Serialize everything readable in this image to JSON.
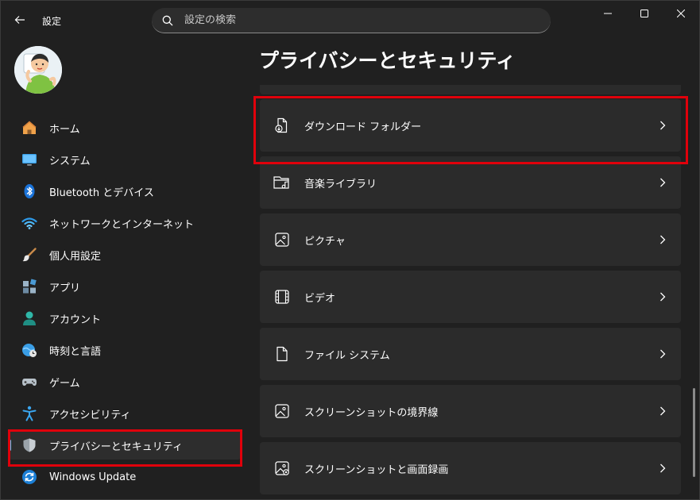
{
  "titlebar": {
    "app_title": "設定",
    "search_placeholder": "設定の検索"
  },
  "page": {
    "title": "プライバシーとセキュリティ"
  },
  "sidebar": {
    "items": [
      {
        "label": "ホーム",
        "icon": "home-icon",
        "selected": false
      },
      {
        "label": "システム",
        "icon": "system-icon",
        "selected": false
      },
      {
        "label": "Bluetooth とデバイス",
        "icon": "bluetooth-icon",
        "selected": false
      },
      {
        "label": "ネットワークとインターネット",
        "icon": "wifi-icon",
        "selected": false
      },
      {
        "label": "個人用設定",
        "icon": "brush-icon",
        "selected": false
      },
      {
        "label": "アプリ",
        "icon": "apps-icon",
        "selected": false
      },
      {
        "label": "アカウント",
        "icon": "account-icon",
        "selected": false
      },
      {
        "label": "時刻と言語",
        "icon": "time-language-icon",
        "selected": false
      },
      {
        "label": "ゲーム",
        "icon": "gamepad-icon",
        "selected": false
      },
      {
        "label": "アクセシビリティ",
        "icon": "accessibility-icon",
        "selected": false
      },
      {
        "label": "プライバシーとセキュリティ",
        "icon": "shield-icon",
        "selected": true
      },
      {
        "label": "Windows Update",
        "icon": "update-icon",
        "selected": false
      }
    ]
  },
  "main": {
    "cards": [
      {
        "label": "ダウンロード フォルダー",
        "icon": "download-folder-icon"
      },
      {
        "label": "音楽ライブラリ",
        "icon": "music-folder-icon"
      },
      {
        "label": "ピクチャ",
        "icon": "picture-icon"
      },
      {
        "label": "ビデオ",
        "icon": "video-icon"
      },
      {
        "label": "ファイル システム",
        "icon": "file-icon"
      },
      {
        "label": "スクリーンショットの境界線",
        "icon": "screenshot-border-icon"
      },
      {
        "label": "スクリーンショットと画面録画",
        "icon": "screen-recording-icon"
      }
    ]
  },
  "colors": {
    "background": "#202020",
    "card": "#2b2b2b",
    "accent": "#60cdff",
    "highlight_box": "#e0000b"
  }
}
